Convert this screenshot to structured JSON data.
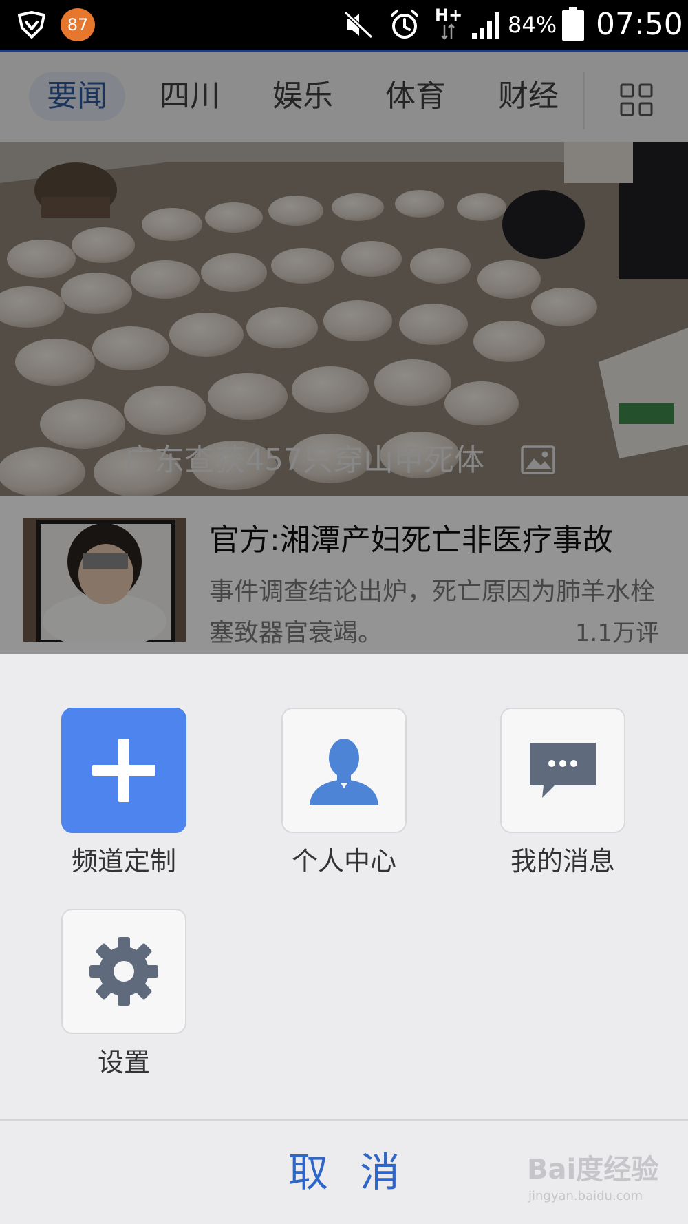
{
  "status_bar": {
    "notification_count": "87",
    "battery_percent": "84%",
    "time": "07:50",
    "icons": [
      "shield-icon",
      "mute-icon",
      "alarm-icon",
      "network-hplus-icon",
      "signal-icon",
      "battery-icon"
    ]
  },
  "tabs": [
    {
      "label": "要闻",
      "active": true
    },
    {
      "label": "四川",
      "active": false
    },
    {
      "label": "娱乐",
      "active": false
    },
    {
      "label": "体育",
      "active": false
    },
    {
      "label": "财经",
      "active": false
    }
  ],
  "hero": {
    "caption": "广东查获457只穿山甲死体"
  },
  "news": [
    {
      "title": "官方:湘潭产妇死亡非医疗事故",
      "description": "事件调查结论出炉，死亡原因为肺羊水栓塞致器官衰竭。",
      "comments": "1.1万评"
    }
  ],
  "menu": {
    "items": [
      {
        "label": "频道定制",
        "icon": "plus-icon"
      },
      {
        "label": "个人中心",
        "icon": "user-icon"
      },
      {
        "label": "我的消息",
        "icon": "message-icon"
      },
      {
        "label": "设置",
        "icon": "gear-icon"
      }
    ],
    "cancel_label": "取消"
  },
  "watermark": {
    "logo": "Bai度经验",
    "url": "jingyan.baidu.com"
  },
  "colors": {
    "accent_blue": "#4d84ee",
    "cancel_blue": "#2f66c8",
    "badge_orange": "#e8772e",
    "icon_gray": "#5f6a7d",
    "user_icon_blue": "#4d84d6"
  }
}
